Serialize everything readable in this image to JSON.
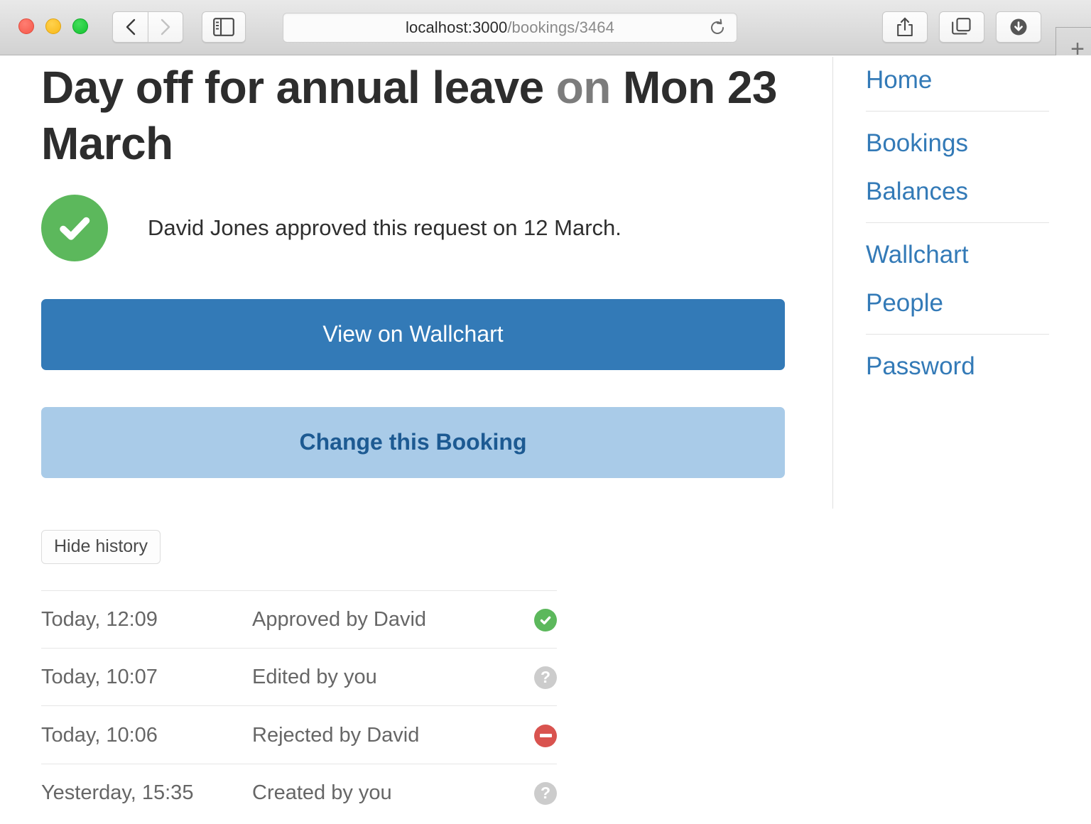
{
  "browser": {
    "window_controls": [
      "close",
      "minimize",
      "zoom"
    ],
    "back_label": "Back",
    "forward_label": "Forward",
    "sidebar_toggle_label": "Show Sidebar",
    "url_host": "localhost:3000",
    "url_path": "/bookings/3464",
    "url_full": "localhost:3000/bookings/3464",
    "reload_label": "Reload",
    "share_label": "Share",
    "tabs_label": "Show Tab Overview",
    "downloads_label": "Downloads",
    "new_tab_label": "+"
  },
  "main": {
    "title_primary": "Day off for annual leave",
    "title_preposition": " on ",
    "title_date": "Mon 23 March",
    "status": {
      "icon": "check-circle-icon",
      "color": "#5cb85c",
      "message": "David Jones approved this request on 12 March."
    },
    "actions": {
      "primary_label": "View on Wallchart",
      "primary_color": "#337ab7",
      "secondary_label": "Change this Booking",
      "secondary_color": "#a9cbe8"
    },
    "history": {
      "toggle_label": "Hide history",
      "rows": [
        {
          "time": "Today, 12:09",
          "action": "Approved by David",
          "status": "approved",
          "icon": "check-circle-icon",
          "color": "#5cb85c"
        },
        {
          "time": "Today, 10:07",
          "action": "Edited by you",
          "status": "unknown",
          "icon": "question-circle-icon",
          "color": "#cccccc"
        },
        {
          "time": "Today, 10:06",
          "action": "Rejected by David",
          "status": "rejected",
          "icon": "minus-circle-icon",
          "color": "#d9534f"
        },
        {
          "time": "Yesterday, 15:35",
          "action": "Created by you",
          "status": "unknown",
          "icon": "question-circle-icon",
          "color": "#cccccc"
        }
      ]
    }
  },
  "sidebar": {
    "link_color": "#337ab7",
    "groups": [
      {
        "items": [
          {
            "label": "Home"
          }
        ]
      },
      {
        "items": [
          {
            "label": "Bookings"
          },
          {
            "label": "Balances"
          }
        ]
      },
      {
        "items": [
          {
            "label": "Wallchart"
          },
          {
            "label": "People"
          }
        ]
      },
      {
        "items": [
          {
            "label": "Password"
          }
        ]
      }
    ]
  }
}
